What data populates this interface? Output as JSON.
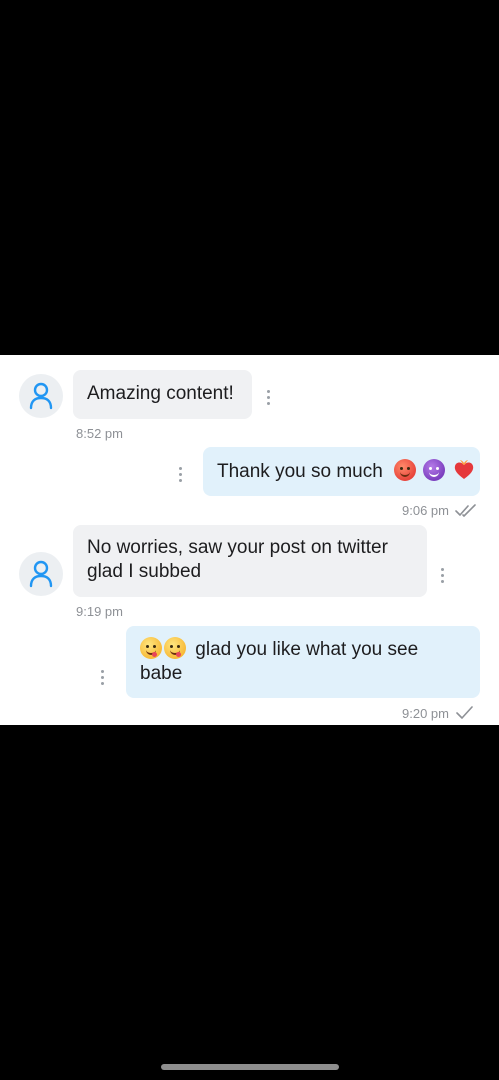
{
  "messages": [
    {
      "direction": "incoming",
      "text": "Amazing content!",
      "time": "8:52 pm"
    },
    {
      "direction": "outgoing",
      "text": "Thank you so much",
      "emojis": [
        "hot-face-emoji",
        "smiling-devil-emoji",
        "heart-on-fire-emoji"
      ],
      "time": "9:06 pm",
      "status": "read"
    },
    {
      "direction": "incoming",
      "line1": "No worries, saw your post on twitter",
      "line2": "glad I subbed",
      "time": "9:19 pm"
    },
    {
      "direction": "outgoing",
      "emojis": [
        "yum-face-emoji",
        "yum-face-emoji"
      ],
      "line1": "glad you like what you see",
      "line2": "babe",
      "time": "9:20 pm",
      "status": "delivered"
    }
  ],
  "colors": {
    "incoming_bubble": "#f0f1f3",
    "outgoing_bubble": "#e1f1fb",
    "avatar_icon": "#2196f3",
    "timestamp": "#8e9196"
  },
  "icons": {
    "avatar": "user-icon",
    "menu": "more-vertical-icon",
    "read": "double-check-icon",
    "delivered": "check-icon"
  }
}
